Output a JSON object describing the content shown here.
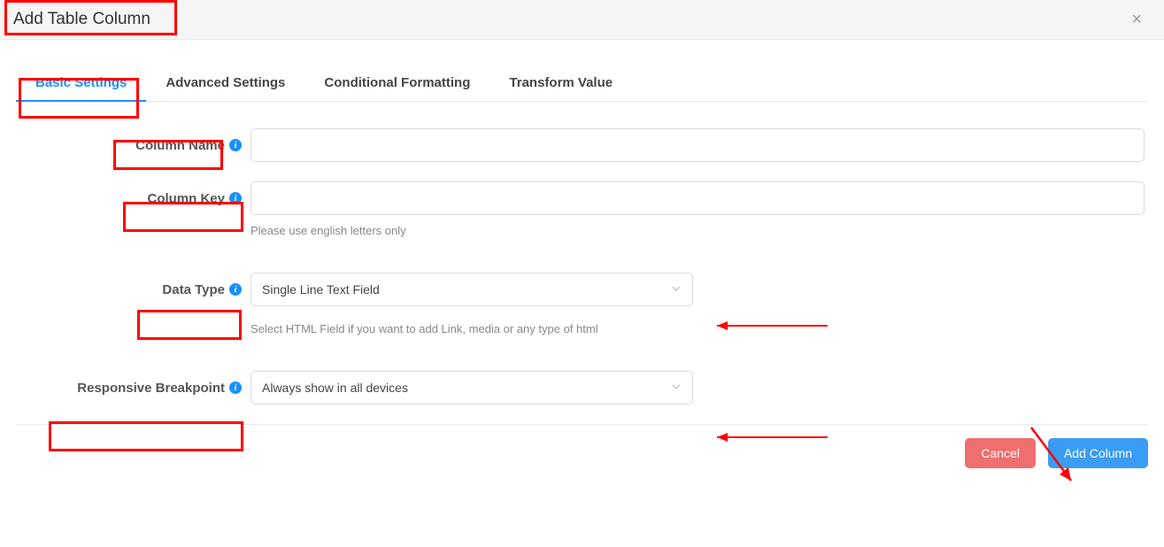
{
  "modal": {
    "title": "Add Table Column",
    "close_label": "×"
  },
  "tabs": [
    {
      "label": "Basic Settings",
      "active": true
    },
    {
      "label": "Advanced Settings",
      "active": false
    },
    {
      "label": "Conditional Formatting",
      "active": false
    },
    {
      "label": "Transform Value",
      "active": false
    }
  ],
  "fields": {
    "column_name": {
      "label": "Column Name",
      "value": ""
    },
    "column_key": {
      "label": "Column Key",
      "value": "",
      "help": "Please use english letters only"
    },
    "data_type": {
      "label": "Data Type",
      "selected": "Single Line Text Field",
      "help": "Select HTML Field if you want to add Link, media or any type of html"
    },
    "responsive_breakpoint": {
      "label": "Responsive Breakpoint",
      "selected": "Always show in all devices"
    }
  },
  "footer": {
    "cancel": "Cancel",
    "submit": "Add Column"
  },
  "icons": {
    "info": "i",
    "chevron_down": "⌄"
  }
}
